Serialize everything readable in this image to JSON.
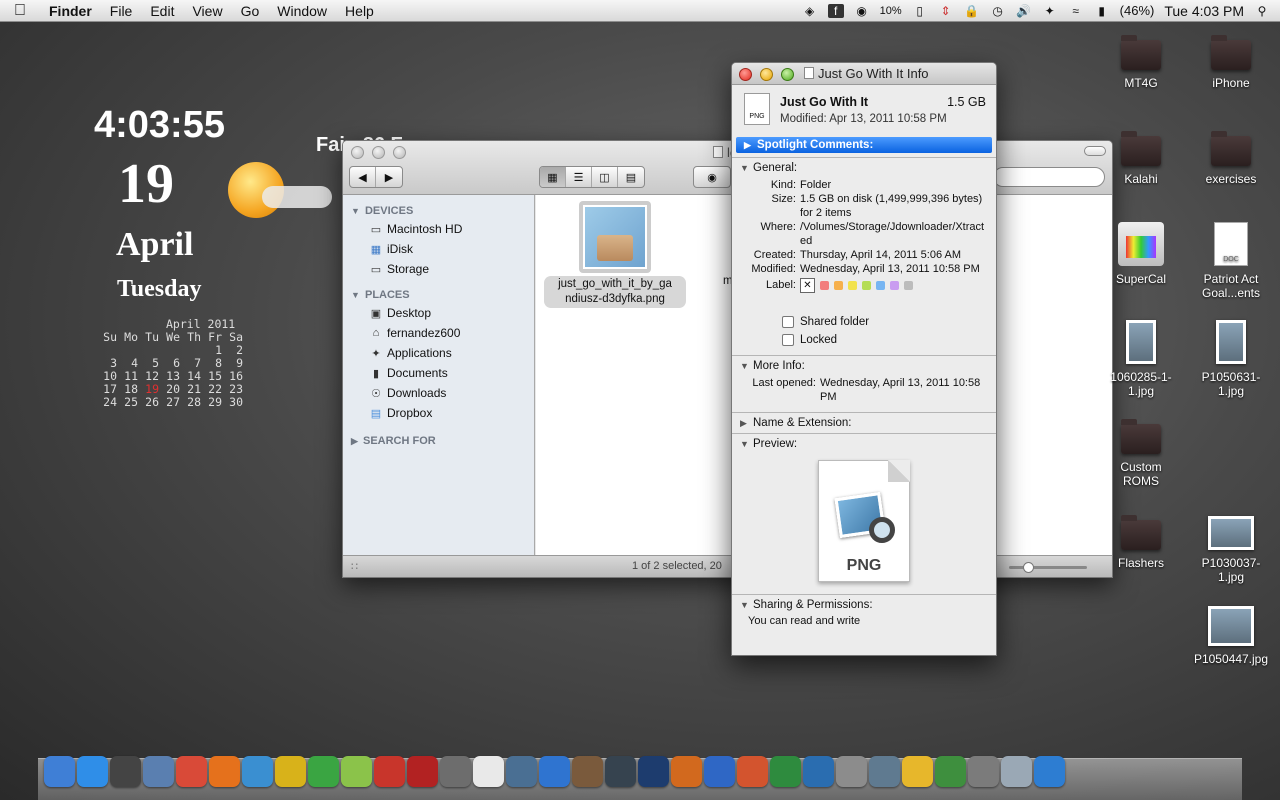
{
  "menubar": {
    "app_name": "Finder",
    "menus": [
      "File",
      "Edit",
      "View",
      "Go",
      "Window",
      "Help"
    ],
    "cpu_percent": "10%",
    "battery": "(46%)",
    "clock": "Tue 4:03 PM"
  },
  "widgets": {
    "time": "4:03:55",
    "day": "19",
    "month": "April",
    "weekday": "Tuesday",
    "weather_text": "Fair, 86 F",
    "calendar": {
      "title": "April 2011",
      "weekdays": [
        "Su",
        "Mo",
        "Tu",
        "We",
        "Th",
        "Fr",
        "Sa"
      ],
      "weeks": [
        [
          "",
          "",
          "",
          "",
          "",
          "1",
          "2"
        ],
        [
          "3",
          "4",
          "5",
          "6",
          "7",
          "8",
          "9"
        ],
        [
          "10",
          "11",
          "12",
          "13",
          "14",
          "15",
          "16"
        ],
        [
          "17",
          "18",
          "19",
          "20",
          "21",
          "22",
          "23"
        ],
        [
          "24",
          "25",
          "26",
          "27",
          "28",
          "29",
          "30"
        ]
      ],
      "today": "19"
    }
  },
  "finder": {
    "title": "lc",
    "sidebar": {
      "devices_header": "DEVICES",
      "devices": [
        {
          "label": "Macintosh HD",
          "icon": "hard-drive-icon"
        },
        {
          "label": "iDisk",
          "icon": "idisk-icon"
        },
        {
          "label": "Storage",
          "icon": "drive-icon"
        }
      ],
      "places_header": "PLACES",
      "places": [
        {
          "label": "Desktop",
          "icon": "desktop-icon"
        },
        {
          "label": "fernandez600",
          "icon": "home-icon"
        },
        {
          "label": "Applications",
          "icon": "applications-icon"
        },
        {
          "label": "Documents",
          "icon": "documents-icon"
        },
        {
          "label": "Downloads",
          "icon": "downloads-icon"
        },
        {
          "label": "Dropbox",
          "icon": "folder-icon"
        }
      ],
      "search_header": "SEARCH FOR"
    },
    "files": [
      {
        "name_line1": "just_go_with_it_by_ga",
        "name_line2": "ndiusz-d3dyfka.png"
      },
      {
        "name_line1": "mo"
      }
    ],
    "status": "1 of 2 selected, 20"
  },
  "info": {
    "title": "Just Go With It Info",
    "name": "Just Go With It",
    "size": "1.5 GB",
    "modified_summary": "Modified: Apr 13, 2011 10:58 PM",
    "spotlight_label": "Spotlight Comments:",
    "general_label": "General:",
    "kind_k": "Kind:",
    "kind_v": "Folder",
    "size_k": "Size:",
    "size_v": "1.5 GB on disk (1,499,999,396 bytes) for 2 items",
    "where_k": "Where:",
    "where_v": "/Volumes/Storage/Jdownloader/Xtracted",
    "created_k": "Created:",
    "created_v": "Thursday, April 14, 2011 5:06 AM",
    "modified_k": "Modified:",
    "modified_v": "Wednesday, April 13, 2011 10:58 PM",
    "label_k": "Label:",
    "label_colors": [
      "#f27c7c",
      "#f6b04c",
      "#f2e24c",
      "#b5dd55",
      "#77b5f2",
      "#c99cf0",
      "#bcbcbc"
    ],
    "shared_folder": "Shared folder",
    "locked": "Locked",
    "more_info_label": "More Info:",
    "last_opened_k": "Last opened:",
    "last_opened_v": "Wednesday, April 13, 2011 10:58 PM",
    "name_ext_label": "Name & Extension:",
    "preview_label": "Preview:",
    "preview_caption": "PNG",
    "sharing_label": "Sharing & Permissions:",
    "permission_text": "You can read and write"
  },
  "desktop_icons": [
    {
      "label": "MT4G",
      "type": "folder"
    },
    {
      "label": "iPhone",
      "type": "folder"
    },
    {
      "label": "Kalahi",
      "type": "folder"
    },
    {
      "label": "exercises",
      "type": "folder"
    },
    {
      "label": "SuperCal",
      "type": "app"
    },
    {
      "label": "Patriot Act Goal...ents",
      "type": "doc"
    },
    {
      "label": "1060285-1-1.jpg",
      "type": "photo"
    },
    {
      "label": "P1050631-1.jpg",
      "type": "photo"
    },
    {
      "label": "Custom ROMS",
      "type": "folder"
    },
    {
      "label": "Flashers",
      "type": "folder"
    },
    {
      "label": "P1030037-1.jpg",
      "type": "photo"
    },
    {
      "label": "P1050447.jpg",
      "type": "photo"
    }
  ],
  "dock": [
    {
      "name": "finder",
      "color": "#3f7fd6"
    },
    {
      "name": "app-store",
      "color": "#2f8ee8"
    },
    {
      "name": "dashboard",
      "color": "#444444"
    },
    {
      "name": "preview",
      "color": "#5a7fb0"
    },
    {
      "name": "chrome",
      "color": "#d94a38"
    },
    {
      "name": "firefox",
      "color": "#e5711c"
    },
    {
      "name": "safari",
      "color": "#3a8fd1"
    },
    {
      "name": "growl",
      "color": "#d8b21a"
    },
    {
      "name": "utorrent",
      "color": "#3aa542"
    },
    {
      "name": "picasa",
      "color": "#8bc34a"
    },
    {
      "name": "angry-birds",
      "color": "#c8352b"
    },
    {
      "name": "photo-booth",
      "color": "#b22222"
    },
    {
      "name": "facetime",
      "color": "#6d6d6d"
    },
    {
      "name": "ical",
      "color": "#e9e9e9"
    },
    {
      "name": "iphoto",
      "color": "#4a6f93"
    },
    {
      "name": "itunes",
      "color": "#2f74d0"
    },
    {
      "name": "image-capture",
      "color": "#7a5a3c"
    },
    {
      "name": "lightroom",
      "color": "#36434f"
    },
    {
      "name": "photoshop",
      "color": "#1d3c6e"
    },
    {
      "name": "illustrator",
      "color": "#d2691e"
    },
    {
      "name": "word",
      "color": "#2f67c5"
    },
    {
      "name": "powerpoint",
      "color": "#d3542e"
    },
    {
      "name": "excel",
      "color": "#2e8b3e"
    },
    {
      "name": "cyberduck",
      "color": "#2a6db0"
    },
    {
      "name": "satellite",
      "color": "#8c8c8c"
    },
    {
      "name": "system-preferences",
      "color": "#5f7a90"
    },
    {
      "name": "adium",
      "color": "#e7b72b"
    },
    {
      "name": "globe",
      "color": "#3e8f3e"
    },
    {
      "name": "network",
      "color": "#7b7b7b"
    },
    {
      "name": "scanner",
      "color": "#9aa8b5"
    },
    {
      "name": "quicktime",
      "color": "#2d7dd2"
    }
  ]
}
